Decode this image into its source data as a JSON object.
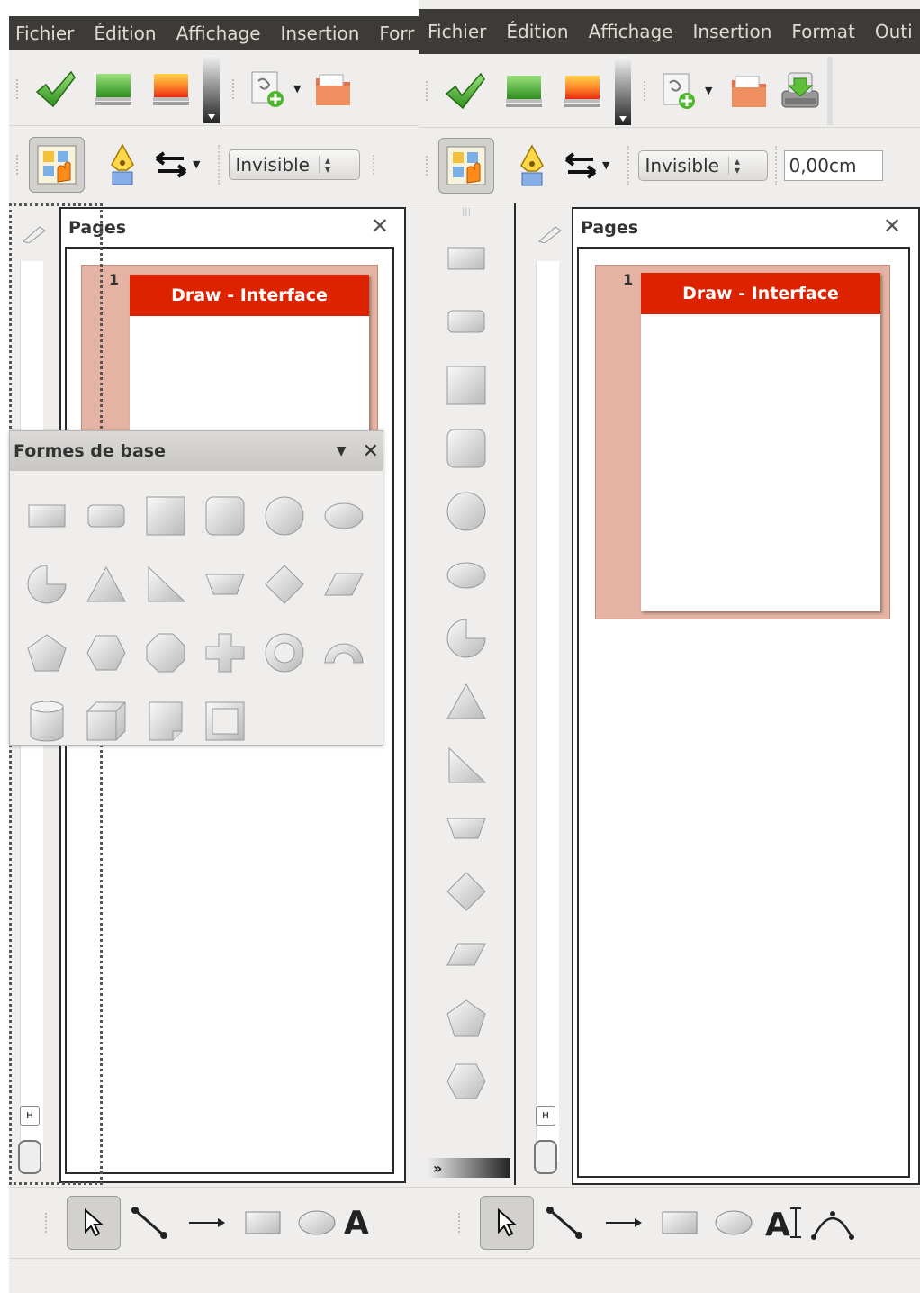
{
  "left": {
    "menu": [
      "Fichier",
      "Édition",
      "Affichage",
      "Insertion",
      "Forr"
    ],
    "line_style_select": "Invisible",
    "pages_panel": {
      "title": "Pages",
      "close": "✕",
      "slide_number": "1",
      "slide_title": "Draw - Interface"
    },
    "shapes_panel": {
      "title": "Formes de base",
      "menu_arrow": "▼",
      "close": "✕"
    },
    "drawing_text_tool": "A"
  },
  "right": {
    "menu": [
      "Fichier",
      "Édition",
      "Affichage",
      "Insertion",
      "Format",
      "Outi"
    ],
    "line_style_select": "Invisible",
    "line_width_input": "0,00cm",
    "pages_panel": {
      "title": "Pages",
      "close": "✕",
      "slide_number": "1",
      "slide_title": "Draw - Interface"
    },
    "overflow_chevron": "»"
  },
  "colors": {
    "menubar_bg": "#3c3b37",
    "menubar_text": "#dfdbd2",
    "slide_header": "#dd2200",
    "slide_frame": "#e4b3a3",
    "toolbar_bg": "#efeeed"
  },
  "shapes": [
    "rectangle",
    "rectangle-rounded",
    "square",
    "square-rounded",
    "circle",
    "ellipse",
    "circle-pie",
    "isosceles-triangle",
    "right-triangle",
    "trapezoid",
    "diamond",
    "parallelogram",
    "pentagon",
    "hexagon",
    "octagon",
    "cross",
    "ring",
    "block-arc",
    "cylinder",
    "cube",
    "folded-corner",
    "frame"
  ]
}
